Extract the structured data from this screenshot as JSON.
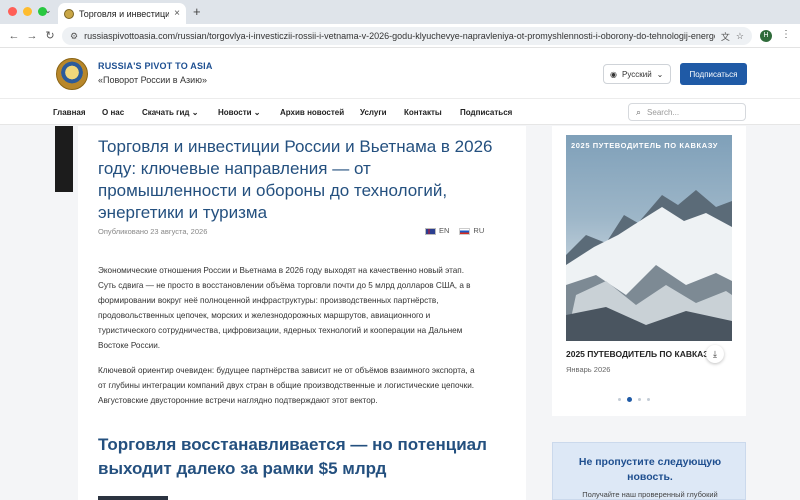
{
  "browser": {
    "tab_title": "Торговля и инвестиции Росс",
    "url": "russiaspivottoasia.com/russian/torgovlya-i-investiczii-rossii-i-vetnama-v-2026-godu-klyuchevye-napravleniya-ot-promyshlennosti-i-oborony-do-tehnologij-energetiki",
    "profile_initial": "H",
    "new_tab": "+"
  },
  "header": {
    "brand_title": "RUSSIA'S PIVOT TO ASIA",
    "brand_subtitle": "«Поворот России в Азию»",
    "language": "Русский",
    "subscribe": "Подписаться"
  },
  "nav": {
    "items": [
      "Главная",
      "О нас",
      "Скачать гид",
      "Новости",
      "Архив новостей",
      "Услуги",
      "Контакты",
      "Подписаться"
    ],
    "search_placeholder": "Search..."
  },
  "article": {
    "title": "Торговля и инвестиции России и Вьетнама в 2026 году: ключевые направления — от промышленности и обороны до технологий, энергетики и туризма",
    "published": "Опубликовано 23 августа, 2026",
    "lang_en": "EN",
    "lang_ru": "RU",
    "paragraph1": "Экономические отношения России и Вьетнама в 2026 году выходят на качественно новый этап. Суть сдвига — не просто в восстановлении объёма торговли почти до 5 млрд долларов США, а в формировании вокруг неё полноценной инфраструктуры: производственных партнёрств, продовольственных цепочек, морских и железнодорожных маршрутов, авиационного и туристического сотрудничества, цифровизации, ядерных технологий и кооперации на Дальнем Востоке России.",
    "paragraph2": "Ключевой ориентир очевиден: будущее партнёрства зависит не от объёмов взаимного экспорта, а от глубины интеграции компаний двух стран в общие производственные и логистические цепочки. Августовские двусторонние встречи наглядно подтверждают этот вектор.",
    "heading2": "Торговля восстанавливается — но потенциал выходит далеко за рамки $5 млрд"
  },
  "sidebar": {
    "image_label": "2025 ПУТЕВОДИТЕЛЬ ПО КАВКАЗУ",
    "card_title": "2025 ПУТЕВОДИТЕЛЬ ПО КАВКАЗУ",
    "card_date": "Январь 2026",
    "carousel_dots": 4,
    "carousel_active": 2,
    "newsletter_title": "Не пропустите следующую новость.",
    "newsletter_text": "Получайте наш проверенный глубокий"
  },
  "colors": {
    "accent": "#1f5aa6",
    "heading": "#24507f",
    "newsletter_bg": "#dde8f6"
  }
}
